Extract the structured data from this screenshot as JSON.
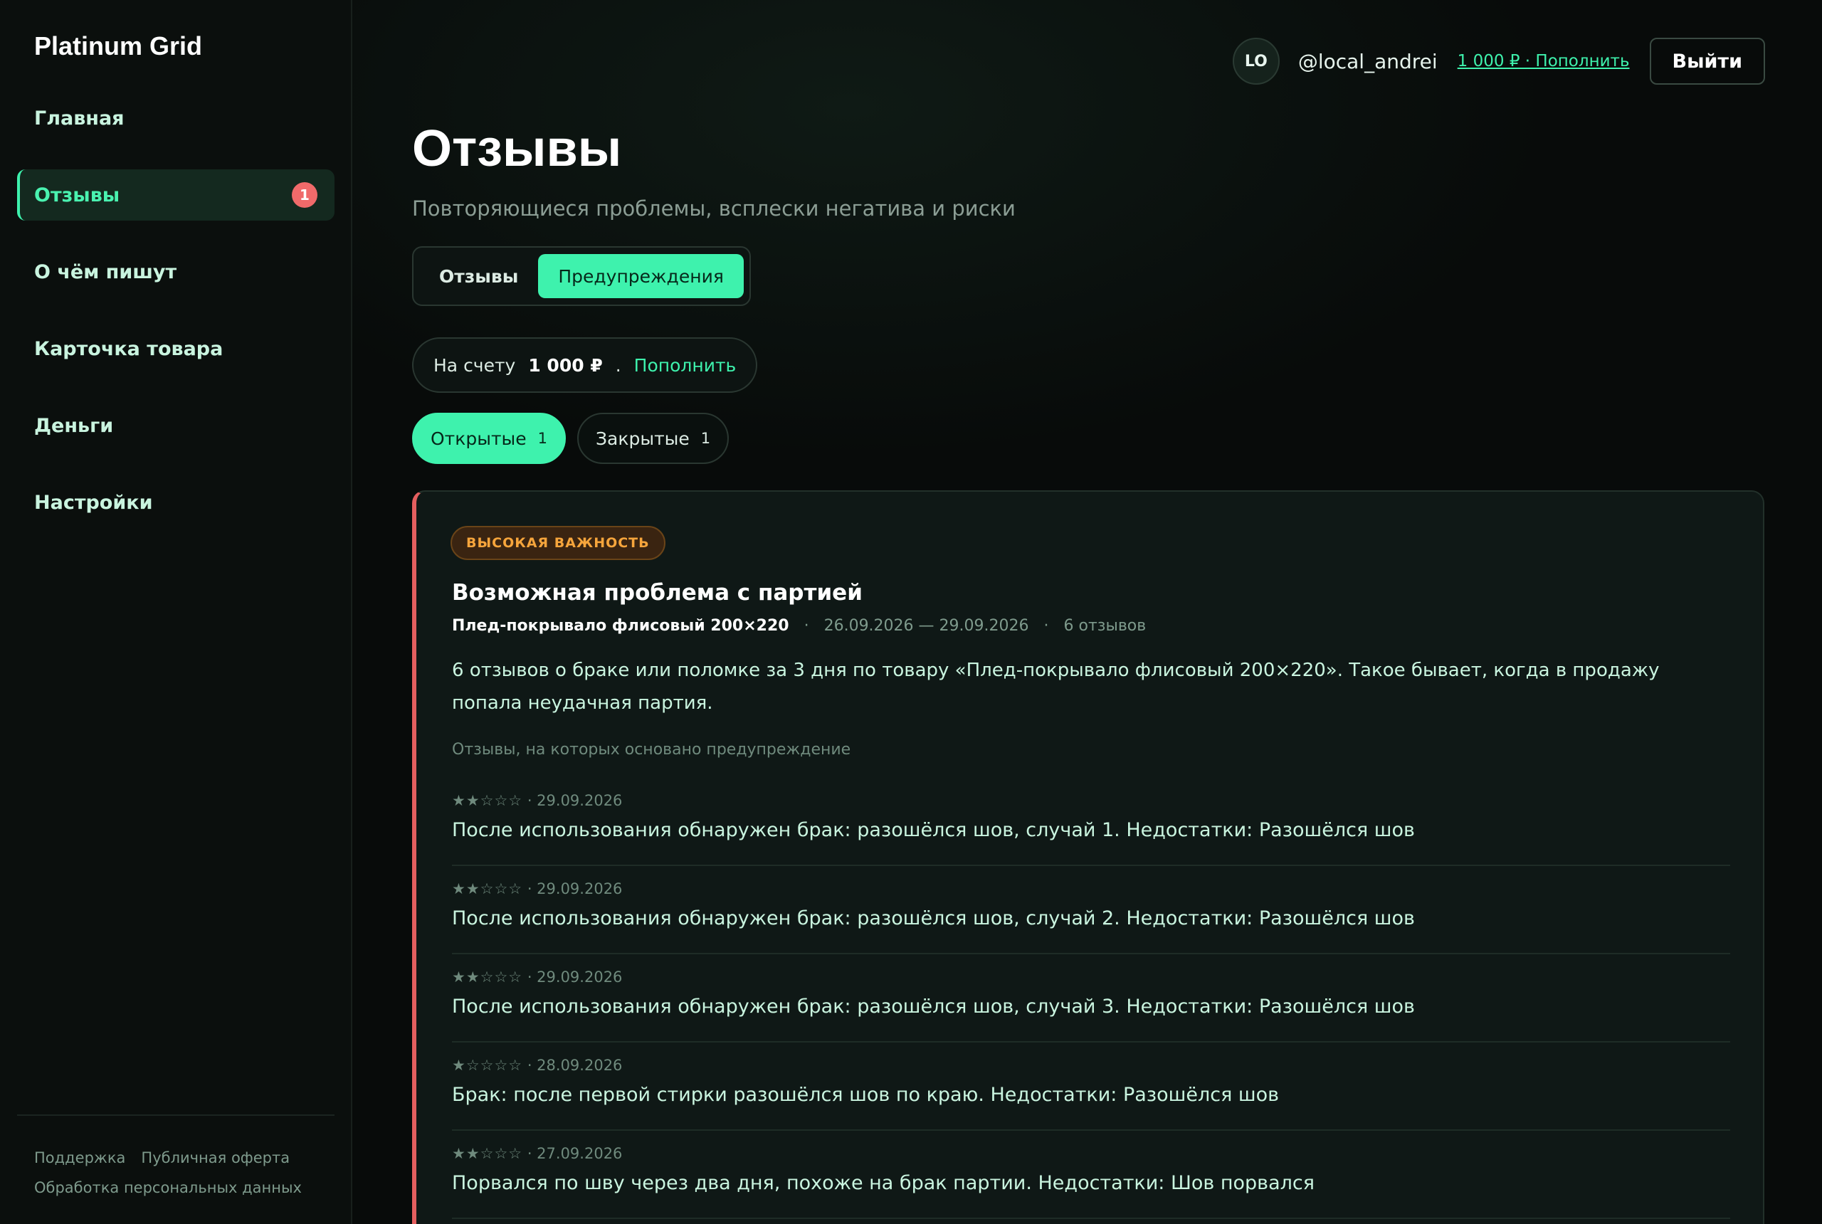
{
  "brand": "Platinum Grid",
  "sidebar": {
    "items": [
      {
        "label": "Главная"
      },
      {
        "label": "Отзывы",
        "badge": "1"
      },
      {
        "label": "О чём пишут"
      },
      {
        "label": "Карточка товара"
      },
      {
        "label": "Деньги"
      },
      {
        "label": "Настройки"
      }
    ],
    "footer": {
      "support": "Поддержка",
      "offer": "Публичная оферта",
      "privacy": "Обработка персональных данных"
    }
  },
  "topbar": {
    "avatar_initials": "LO",
    "username": "@local_andrei",
    "balance_link": "1 000 ₽ · Пополнить",
    "logout": "Выйти"
  },
  "page": {
    "title": "Отзывы",
    "subtitle": "Повторяющиеся проблемы, всплески негатива и риски"
  },
  "segment": {
    "reviews": "Отзывы",
    "warnings": "Предупреждения"
  },
  "balance": {
    "label": "На счету",
    "amount": "1 000 ₽",
    "separator": ".",
    "topup": "Пополнить"
  },
  "filters": {
    "open": {
      "label": "Открытые",
      "count": "1"
    },
    "closed": {
      "label": "Закрытые",
      "count": "1"
    }
  },
  "alert": {
    "severity": "ВЫСОКАЯ ВАЖНОСТЬ",
    "title": "Возможная проблема с партией",
    "product": "Плед-покрывало флисовый 200×220",
    "period": "26.09.2026 — 29.09.2026",
    "count": "6 отзывов",
    "meta_sep": "·",
    "description": "6 отзывов о браке или поломке за 3 дня по товару «Плед-покрывало флисовый 200×220». Такое бывает, когда в продажу попала неудачная партия.",
    "basis_label": "Отзывы, на которых основано предупреждение",
    "reviews": [
      {
        "stars": "★★☆☆☆",
        "date": "· 29.09.2026",
        "text": "После использования обнаружен брак: разошёлся шов, случай 1. Недостатки: Разошёлся шов"
      },
      {
        "stars": "★★☆☆☆",
        "date": "· 29.09.2026",
        "text": "После использования обнаружен брак: разошёлся шов, случай 2. Недостатки: Разошёлся шов"
      },
      {
        "stars": "★★☆☆☆",
        "date": "· 29.09.2026",
        "text": "После использования обнаружен брак: разошёлся шов, случай 3. Недостатки: Разошёлся шов"
      },
      {
        "stars": "★☆☆☆☆",
        "date": "· 28.09.2026",
        "text": "Брак: после первой стирки разошёлся шов по краю. Недостатки: Разошёлся шов"
      },
      {
        "stars": "★★☆☆☆",
        "date": "· 27.09.2026",
        "text": "Порвался по шву через два дня, похоже на брак партии. Недостатки: Шов порвался"
      }
    ]
  },
  "colors": {
    "accent": "#3ef2ad",
    "danger": "#e45f5f",
    "warning": "#f6a53c",
    "background": "#070908"
  }
}
